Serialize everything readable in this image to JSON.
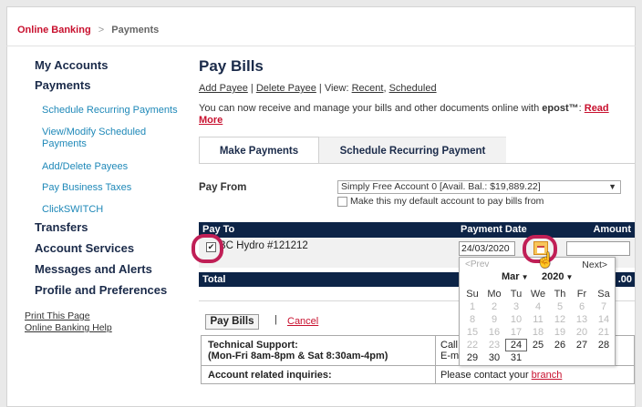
{
  "breadcrumb": {
    "home": "Online Banking",
    "separator": ">",
    "current": "Payments"
  },
  "sidebar": {
    "items": [
      {
        "label": "My Accounts"
      },
      {
        "label": "Payments"
      },
      {
        "label": "Schedule Recurring Payments"
      },
      {
        "label": "View/Modify Scheduled Payments"
      },
      {
        "label": "Add/Delete Payees"
      },
      {
        "label": "Pay Business Taxes"
      },
      {
        "label": "ClickSWITCH"
      },
      {
        "label": "Transfers"
      },
      {
        "label": "Account Services"
      },
      {
        "label": "Messages and Alerts"
      },
      {
        "label": "Profile and Preferences"
      },
      {
        "label": "Print This Page"
      },
      {
        "label": "Online Banking Help"
      }
    ]
  },
  "main": {
    "title": "Pay Bills",
    "links": {
      "add_payee": "Add Payee",
      "sep1": "|",
      "delete_payee": "Delete Payee",
      "sep2": "|",
      "view_label": "View:",
      "recent": "Recent",
      "comma": ",",
      "scheduled": "Scheduled"
    },
    "epost": {
      "text": "You can now receive and manage your bills and other documents online with ",
      "brand": "epost™",
      "colon": ":",
      "read_more": "Read More"
    },
    "tabs": [
      {
        "label": "Make Payments"
      },
      {
        "label": "Schedule Recurring Payment"
      }
    ],
    "pay_from": {
      "label": "Pay From",
      "selected_account": "Simply Free Account 0 [Avail. Bal.: $19,889.22]",
      "default_label": "Make this my default account to pay bills from"
    },
    "table": {
      "headers": {
        "pay_to": "Pay To",
        "payment_date": "Payment Date",
        "amount": "Amount"
      },
      "row": {
        "checked": "✔",
        "payee": "BC Hydro  #121212",
        "date_value": "24/03/2020",
        "amount_value": ""
      },
      "total_label": "Total",
      "total_value": ".00"
    },
    "datepicker": {
      "prev": "<Prev",
      "next": "Next>",
      "month": "Mar",
      "year": "2020",
      "weekdays": [
        "Su",
        "Mo",
        "Tu",
        "We",
        "Th",
        "Fr",
        "Sa"
      ],
      "weeks": [
        [
          "1",
          "2",
          "3",
          "4",
          "5",
          "6",
          "7"
        ],
        [
          "8",
          "9",
          "10",
          "11",
          "12",
          "13",
          "14"
        ],
        [
          "15",
          "16",
          "17",
          "18",
          "19",
          "20",
          "21"
        ],
        [
          "22",
          "23",
          "24",
          "25",
          "26",
          "27",
          "28"
        ],
        [
          "29",
          "30",
          "31",
          "",
          "",
          "",
          ""
        ]
      ]
    },
    "actions": {
      "pay_bills": "Pay Bills",
      "separator": "|",
      "cancel": "Cancel"
    },
    "support": {
      "tech_label_1": "Technical Support:",
      "tech_label_2": "(Mon-Fri 8am-8pm & Sat 8:30am-4pm)",
      "tech_val_1": "Call",
      "tech_val_2": "E-ma",
      "account_label": "Account related inquiries:",
      "account_val": "Please contact your ",
      "branch": "branch"
    }
  }
}
